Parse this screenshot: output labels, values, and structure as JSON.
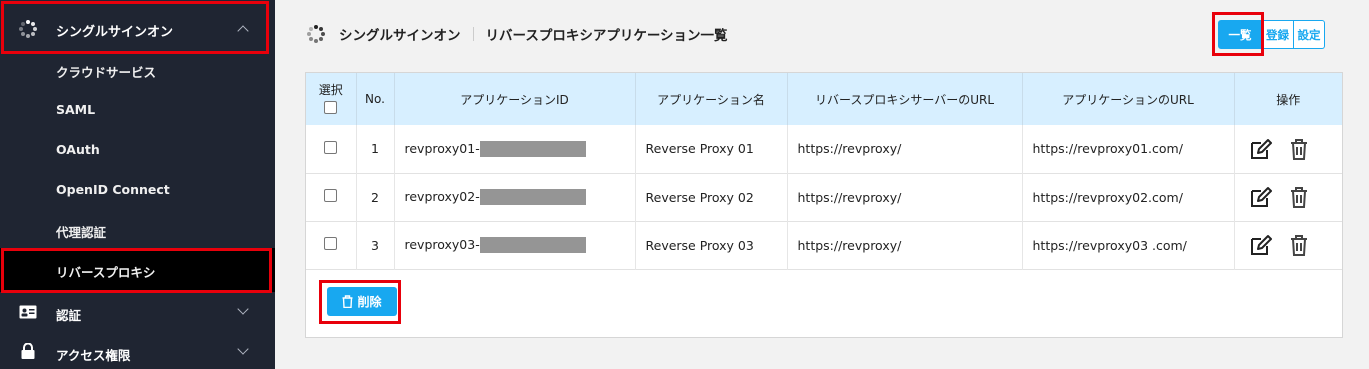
{
  "sidebar": {
    "header": {
      "title": "シングルサインオン",
      "icon": "spinner-icon"
    },
    "sub_items": [
      {
        "label": "クラウドサービス"
      },
      {
        "label": "SAML"
      },
      {
        "label": "OAuth"
      },
      {
        "label": "OpenID Connect"
      },
      {
        "label": "代理認証"
      },
      {
        "label": "リバースプロキシ",
        "active": true
      }
    ],
    "groups": [
      {
        "label": "認証",
        "icon": "id-card-icon"
      },
      {
        "label": "アクセス権限",
        "icon": "lock-icon"
      }
    ]
  },
  "main": {
    "title": "シングルサインオン",
    "subtitle": "リバースプロキシアプリケーション一覧",
    "buttons": {
      "list": "一覧",
      "register": "登録",
      "settings": "設定"
    },
    "table": {
      "headers": {
        "select": "選択",
        "no": "No.",
        "app_id": "アプリケーションID",
        "app_name": "アプリケーション名",
        "proxy_url": "リバースプロキシサーバーのURL",
        "app_url": "アプリケーションのURL",
        "ops": "操作"
      },
      "rows": [
        {
          "no": "1",
          "app_id": "revproxy01-",
          "app_name": "Reverse Proxy 01",
          "proxy_url": "https://revproxy/",
          "app_url": "https://revproxy01.com/"
        },
        {
          "no": "2",
          "app_id": "revproxy02-",
          "app_name": "Reverse Proxy 02",
          "proxy_url": "https://revproxy/",
          "app_url": "https://revproxy02.com/"
        },
        {
          "no": "3",
          "app_id": "revproxy03-",
          "app_name": "Reverse Proxy 03",
          "proxy_url": "https://revproxy/",
          "app_url": "https://revproxy03 .com/"
        }
      ]
    },
    "delete_label": "削除"
  },
  "colors": {
    "accent": "#18a8f0",
    "sidebar_bg": "#1f2532",
    "highlight": "#e8000b",
    "header_bg": "#d7efff"
  }
}
